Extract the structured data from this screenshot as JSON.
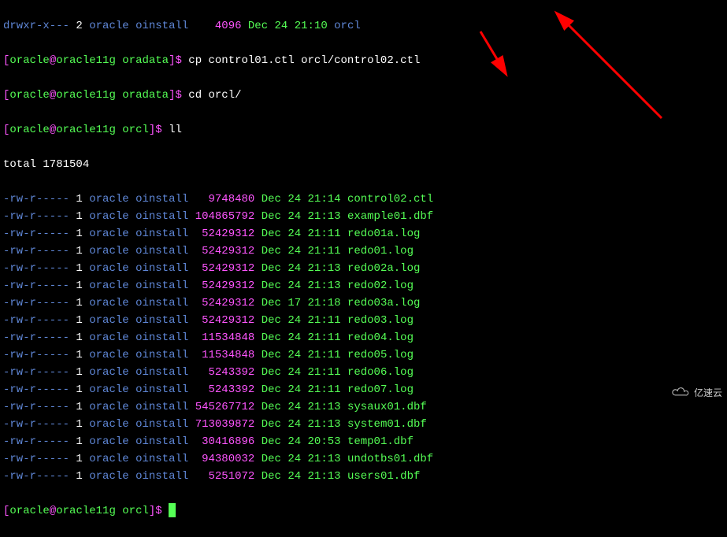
{
  "line0": {
    "perm": "drwxr-x---",
    "links": "2",
    "owner": "oracle",
    "group": "oinstall",
    "size": "   4096",
    "date": "Dec 24 21:10",
    "name": "orcl"
  },
  "cmd1": {
    "prompt_open": "[",
    "user": "oracle",
    "at": "@",
    "host": "oracle11g",
    "dir": "oradata",
    "prompt_close": "]$",
    "command": "cp control01.ctl orcl/control02.ctl"
  },
  "cmd2": {
    "prompt_open": "[",
    "user": "oracle",
    "at": "@",
    "host": "oracle11g",
    "dir": "oradata",
    "prompt_close": "]$",
    "command": "cd orcl/"
  },
  "cmd3": {
    "prompt_open": "[",
    "user": "oracle",
    "at": "@",
    "host": "oracle11g",
    "dir": "orcl",
    "prompt_close": "]$",
    "command": "ll"
  },
  "total": "total 1781504",
  "files": [
    {
      "perm": "-rw-r-----",
      "links": "1",
      "owner": "oracle",
      "group": "oinstall",
      "size": "  9748480",
      "date": "Dec 24 21:14",
      "name": "control02.ctl"
    },
    {
      "perm": "-rw-r-----",
      "links": "1",
      "owner": "oracle",
      "group": "oinstall",
      "size": "104865792",
      "date": "Dec 24 21:13",
      "name": "example01.dbf"
    },
    {
      "perm": "-rw-r-----",
      "links": "1",
      "owner": "oracle",
      "group": "oinstall",
      "size": " 52429312",
      "date": "Dec 24 21:11",
      "name": "redo01a.log"
    },
    {
      "perm": "-rw-r-----",
      "links": "1",
      "owner": "oracle",
      "group": "oinstall",
      "size": " 52429312",
      "date": "Dec 24 21:11",
      "name": "redo01.log"
    },
    {
      "perm": "-rw-r-----",
      "links": "1",
      "owner": "oracle",
      "group": "oinstall",
      "size": " 52429312",
      "date": "Dec 24 21:13",
      "name": "redo02a.log"
    },
    {
      "perm": "-rw-r-----",
      "links": "1",
      "owner": "oracle",
      "group": "oinstall",
      "size": " 52429312",
      "date": "Dec 24 21:13",
      "name": "redo02.log"
    },
    {
      "perm": "-rw-r-----",
      "links": "1",
      "owner": "oracle",
      "group": "oinstall",
      "size": " 52429312",
      "date": "Dec 17 21:18",
      "name": "redo03a.log"
    },
    {
      "perm": "-rw-r-----",
      "links": "1",
      "owner": "oracle",
      "group": "oinstall",
      "size": " 52429312",
      "date": "Dec 24 21:11",
      "name": "redo03.log"
    },
    {
      "perm": "-rw-r-----",
      "links": "1",
      "owner": "oracle",
      "group": "oinstall",
      "size": " 11534848",
      "date": "Dec 24 21:11",
      "name": "redo04.log"
    },
    {
      "perm": "-rw-r-----",
      "links": "1",
      "owner": "oracle",
      "group": "oinstall",
      "size": " 11534848",
      "date": "Dec 24 21:11",
      "name": "redo05.log"
    },
    {
      "perm": "-rw-r-----",
      "links": "1",
      "owner": "oracle",
      "group": "oinstall",
      "size": "  5243392",
      "date": "Dec 24 21:11",
      "name": "redo06.log"
    },
    {
      "perm": "-rw-r-----",
      "links": "1",
      "owner": "oracle",
      "group": "oinstall",
      "size": "  5243392",
      "date": "Dec 24 21:11",
      "name": "redo07.log"
    },
    {
      "perm": "-rw-r-----",
      "links": "1",
      "owner": "oracle",
      "group": "oinstall",
      "size": "545267712",
      "date": "Dec 24 21:13",
      "name": "sysaux01.dbf"
    },
    {
      "perm": "-rw-r-----",
      "links": "1",
      "owner": "oracle",
      "group": "oinstall",
      "size": "713039872",
      "date": "Dec 24 21:13",
      "name": "system01.dbf"
    },
    {
      "perm": "-rw-r-----",
      "links": "1",
      "owner": "oracle",
      "group": "oinstall",
      "size": " 30416896",
      "date": "Dec 24 20:53",
      "name": "temp01.dbf"
    },
    {
      "perm": "-rw-r-----",
      "links": "1",
      "owner": "oracle",
      "group": "oinstall",
      "size": " 94380032",
      "date": "Dec 24 21:13",
      "name": "undotbs01.dbf"
    },
    {
      "perm": "-rw-r-----",
      "links": "1",
      "owner": "oracle",
      "group": "oinstall",
      "size": "  5251072",
      "date": "Dec 24 21:13",
      "name": "users01.dbf"
    }
  ],
  "cmd4": {
    "prompt_open": "[",
    "user": "oracle",
    "at": "@",
    "host": "oracle11g",
    "dir": "orcl",
    "prompt_close": "]$"
  },
  "watermark": "亿速云"
}
